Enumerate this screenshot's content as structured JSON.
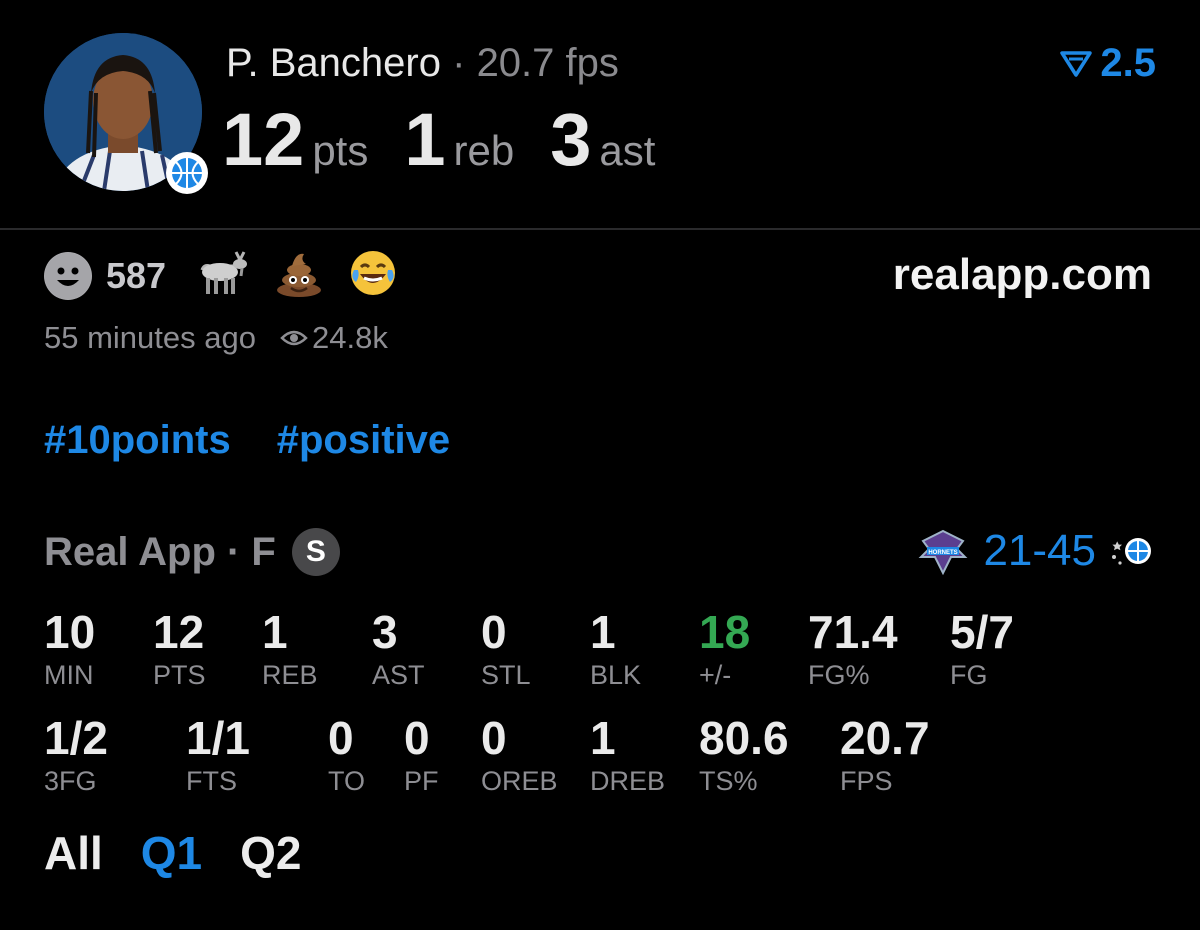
{
  "player": {
    "name": "P. Banchero",
    "separator": "·",
    "fps": "20.7 fps",
    "points": "12",
    "points_unit": "pts",
    "rebounds": "1",
    "rebounds_unit": "reb",
    "assists": "3",
    "assists_unit": "ast",
    "rating": "2.5"
  },
  "reactions": {
    "count": "587",
    "emojis": [
      "goat-icon",
      "poop-emoji",
      "laughing-emoji"
    ]
  },
  "site": "realapp.com",
  "meta": {
    "time": "55 minutes ago",
    "views": "24.8k"
  },
  "tags": [
    "#10points",
    "#positive"
  ],
  "game": {
    "label": "Real App · F",
    "badge": "S",
    "score": "21-45"
  },
  "stats_row1": [
    {
      "value": "10",
      "label": "MIN"
    },
    {
      "value": "12",
      "label": "PTS"
    },
    {
      "value": "1",
      "label": "REB"
    },
    {
      "value": "3",
      "label": "AST"
    },
    {
      "value": "0",
      "label": "STL"
    },
    {
      "value": "1",
      "label": "BLK"
    },
    {
      "value": "18",
      "label": "+/-"
    },
    {
      "value": "71.4",
      "label": "FG%"
    },
    {
      "value": "5/7",
      "label": "FG"
    }
  ],
  "stats_row2": [
    {
      "value": "1/2",
      "label": "3FG"
    },
    {
      "value": "1/1",
      "label": "FTS"
    },
    {
      "value": "0",
      "label": "TO"
    },
    {
      "value": "0",
      "label": "PF"
    },
    {
      "value": "0",
      "label": "OREB"
    },
    {
      "value": "1",
      "label": "DREB"
    },
    {
      "value": "80.6",
      "label": "TS%"
    },
    {
      "value": "20.7",
      "label": "FPS"
    }
  ],
  "periods": [
    "All",
    "Q1",
    "Q2"
  ],
  "active_period": "Q1",
  "colors": {
    "accent": "#1e88e5",
    "positive": "#34a853",
    "muted": "#8e8e93"
  }
}
